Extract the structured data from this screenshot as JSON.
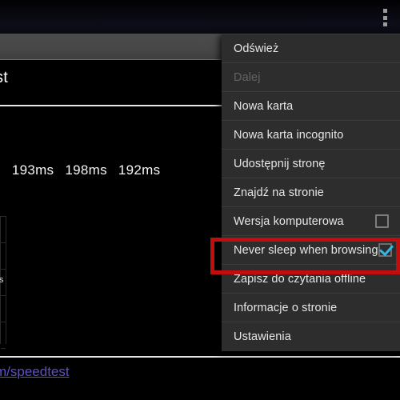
{
  "statusbar": {
    "overflow_icon": "overflow-menu-dots-icon"
  },
  "webpage": {
    "title_fragment": "st",
    "ping_label_fragment": "s",
    "ping_values": [
      "193ms",
      "198ms",
      "192ms"
    ],
    "table_cell_fragment": "s",
    "link_text": "m/speedtest",
    "link_color": "#5b4fc8"
  },
  "menu": {
    "background_color": "#2d2d2d",
    "accent_color": "#35b6e8",
    "highlight_color": "#c00d0d",
    "items": [
      {
        "label": "Odśwież",
        "disabled": false,
        "control": "none"
      },
      {
        "label": "Dalej",
        "disabled": true,
        "control": "none"
      },
      {
        "label": "Nowa karta",
        "disabled": false,
        "control": "none"
      },
      {
        "label": "Nowa karta incognito",
        "disabled": false,
        "control": "none"
      },
      {
        "label": "Udostępnij stronę",
        "disabled": false,
        "control": "none"
      },
      {
        "label": "Znajdź na stronie",
        "disabled": false,
        "control": "none"
      },
      {
        "label": "Wersja komputerowa",
        "disabled": false,
        "control": "checkbox",
        "checked": false
      },
      {
        "label": "Never sleep when browsing",
        "disabled": false,
        "control": "checkbox",
        "checked": true
      },
      {
        "label": "Zapisz do czytania offline",
        "disabled": false,
        "control": "none"
      },
      {
        "label": "Informacje o stronie",
        "disabled": false,
        "control": "none"
      },
      {
        "label": "Ustawienia",
        "disabled": false,
        "control": "none"
      }
    ]
  }
}
